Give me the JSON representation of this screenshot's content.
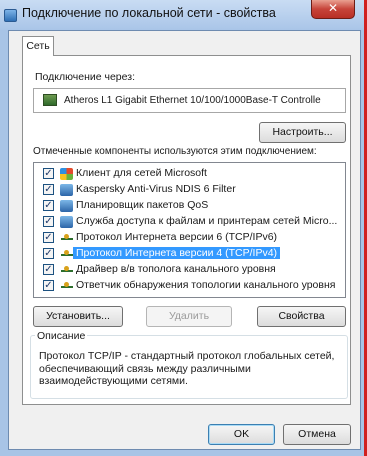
{
  "window": {
    "title": "Подключение по локальной сети - свойства",
    "close_label": "✕"
  },
  "tabs": [
    {
      "label": "Сеть"
    }
  ],
  "connect_via": {
    "label": "Подключение через:",
    "adapter": "Atheros L1 Gigabit Ethernet 10/100/1000Base-T Controlle",
    "configure_button": "Настроить..."
  },
  "components": {
    "label": "Отмеченные компоненты используются этим подключением:",
    "items": [
      {
        "label": "Клиент для сетей Microsoft",
        "checked": true,
        "icon": "network-client-icon"
      },
      {
        "label": "Kaspersky Anti-Virus NDIS 6 Filter",
        "checked": true,
        "icon": "network-service-icon"
      },
      {
        "label": "Планировщик пакетов QoS",
        "checked": true,
        "icon": "network-service-icon"
      },
      {
        "label": "Служба доступа к файлам и принтерам сетей Micro...",
        "checked": true,
        "icon": "network-service-icon"
      },
      {
        "label": "Протокол Интернета версии 6 (TCP/IPv6)",
        "checked": true,
        "icon": "protocol-icon"
      },
      {
        "label": "Протокол Интернета версии 4 (TCP/IPv4)",
        "checked": true,
        "icon": "protocol-icon",
        "selected": true
      },
      {
        "label": "Драйвер в/в тополога канального уровня",
        "checked": true,
        "icon": "protocol-icon"
      },
      {
        "label": "Ответчик обнаружения топологии канального уровня",
        "checked": true,
        "icon": "protocol-icon"
      }
    ]
  },
  "actions": {
    "install": "Установить...",
    "remove": "Удалить",
    "properties": "Свойства"
  },
  "description": {
    "legend": "Описание",
    "text": "Протокол TCP/IP - стандартный протокол глобальных сетей, обеспечивающий связь между различными взаимодействующими сетями."
  },
  "dialog_buttons": {
    "ok": "OK",
    "cancel": "Отмена"
  },
  "colors": {
    "selection": "#3399ff",
    "titlebar": "#a9c5e8",
    "close_button": "#c7443a"
  }
}
